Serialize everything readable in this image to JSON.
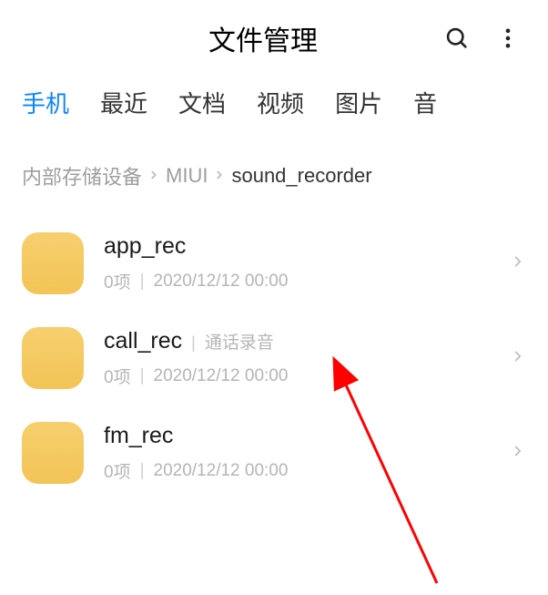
{
  "header": {
    "title": "文件管理"
  },
  "tabs": {
    "items": [
      {
        "label": "手机",
        "active": true
      },
      {
        "label": "最近",
        "active": false
      },
      {
        "label": "文档",
        "active": false
      },
      {
        "label": "视频",
        "active": false
      },
      {
        "label": "图片",
        "active": false
      },
      {
        "label": "音",
        "active": false
      }
    ]
  },
  "breadcrumb": {
    "items": [
      "内部存储设备",
      "MIUI",
      "sound_recorder"
    ]
  },
  "files": {
    "items": [
      {
        "name": "app_rec",
        "subtitle": "",
        "count": "0项",
        "date": "2020/12/12 00:00"
      },
      {
        "name": "call_rec",
        "subtitle": "通话录音",
        "count": "0项",
        "date": "2020/12/12 00:00"
      },
      {
        "name": "fm_rec",
        "subtitle": "",
        "count": "0项",
        "date": "2020/12/12 00:00"
      }
    ]
  }
}
